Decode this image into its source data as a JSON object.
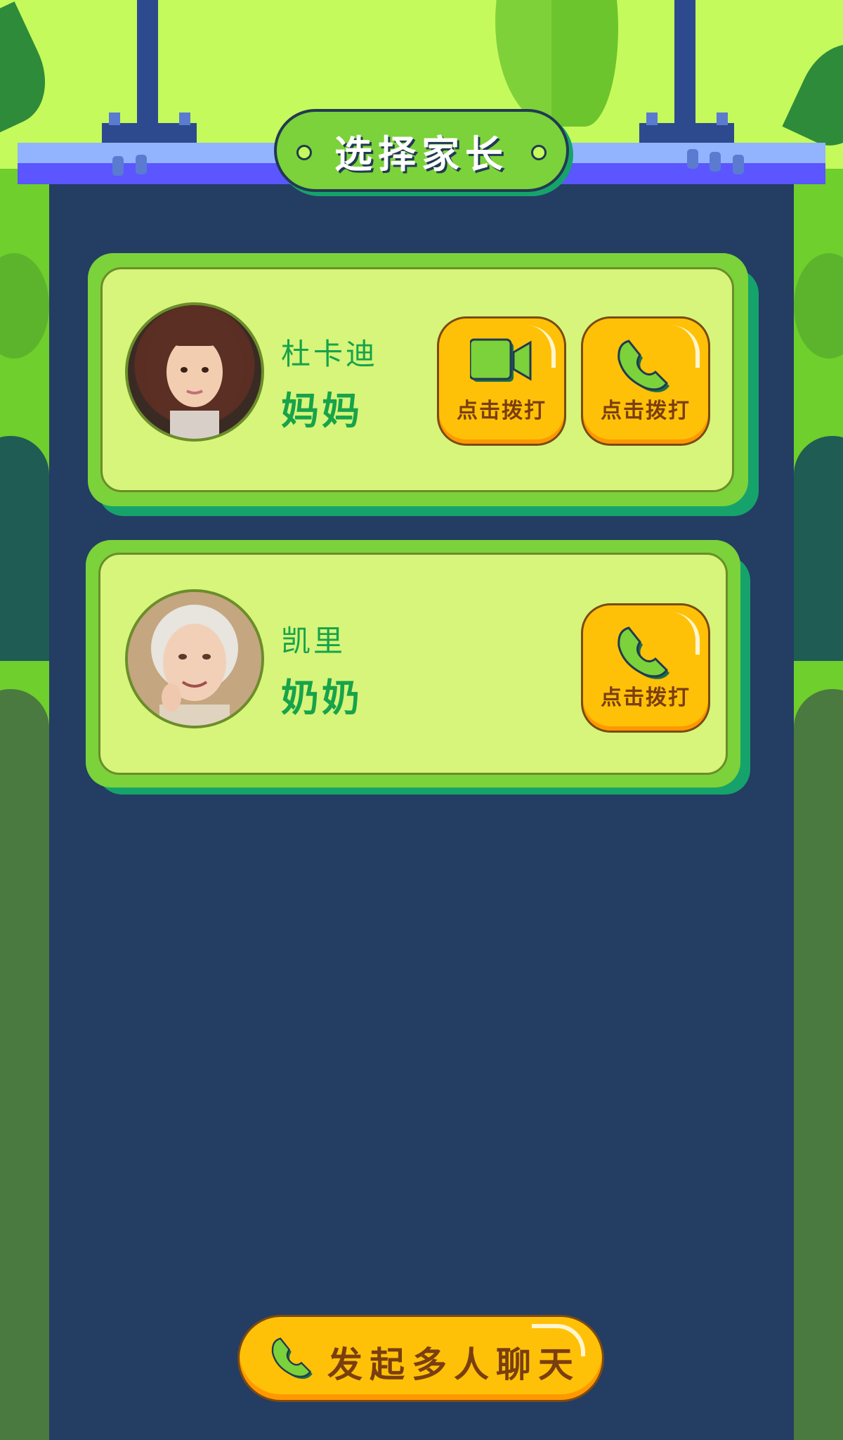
{
  "header": {
    "title": "选择家长"
  },
  "contacts": [
    {
      "name": "杜卡迪",
      "role": "妈妈",
      "actions": [
        {
          "type": "video-call",
          "label": "点击拨打"
        },
        {
          "type": "voice-call",
          "label": "点击拨打"
        }
      ]
    },
    {
      "name": "凯里",
      "role": "奶奶",
      "actions": [
        {
          "type": "voice-call",
          "label": "点击拨打"
        }
      ]
    }
  ],
  "footer": {
    "multi_chat_label": "发起多人聊天"
  },
  "colors": {
    "card_green": "#7bd23a",
    "card_inner": "#d6f57a",
    "button_yellow": "#ffc107",
    "panel_navy": "#243d63",
    "text_green": "#17a34a"
  }
}
